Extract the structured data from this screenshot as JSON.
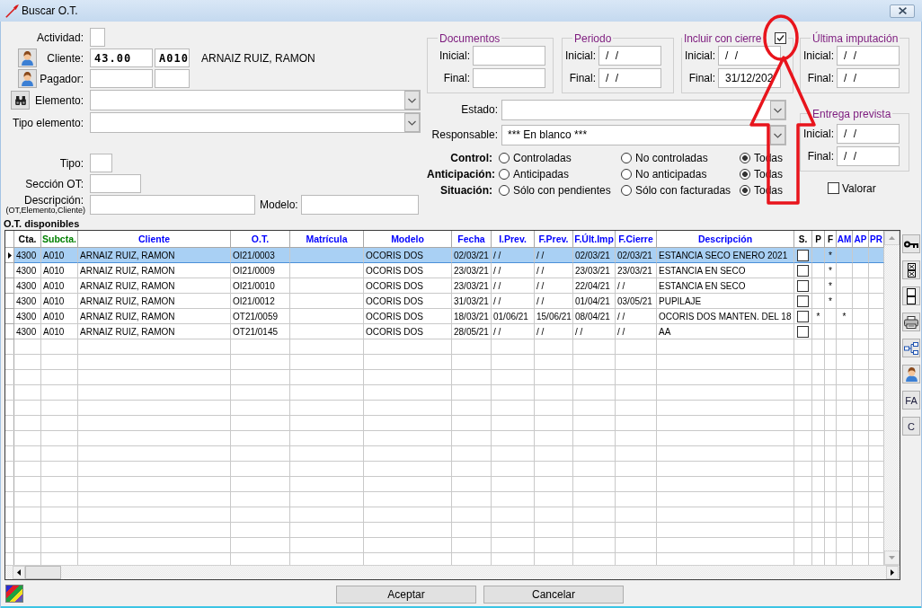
{
  "window": {
    "title": "Buscar O.T."
  },
  "form": {
    "actividad": {
      "label": "Actividad:"
    },
    "cliente": {
      "label": "Cliente:",
      "code": "43.00",
      "subcode": "A010",
      "name": "ARNAIZ RUIZ, RAMON"
    },
    "pagador": {
      "label": "Pagador:"
    },
    "elemento": {
      "label": "Elemento:"
    },
    "tipo_elemento": {
      "label": "Tipo elemento:"
    },
    "tipo": {
      "label": "Tipo:"
    },
    "seccion": {
      "label": "Sección OT:"
    },
    "descripcion": {
      "label": "Descripción:",
      "hint": "(OT,Elemento,Cliente)"
    },
    "modelo": {
      "label": "Modelo:"
    }
  },
  "date_groups": [
    {
      "title": "Documentos",
      "fields": [
        {
          "label": "Inicial:"
        },
        {
          "label": "Final:"
        }
      ]
    },
    {
      "title": "Periodo",
      "fields": [
        {
          "label": "Inicial:",
          "value": "/ /"
        },
        {
          "label": "Final:",
          "value": "/ /"
        }
      ]
    },
    {
      "title": "Incluir con cierre",
      "checkbox": {
        "checked": true
      },
      "fields": [
        {
          "label": "Inicial:",
          "value": "/ /"
        },
        {
          "label": "Final:",
          "value": "31/12/202"
        }
      ]
    },
    {
      "title": "Última imputación",
      "fields": [
        {
          "label": "Inicial:",
          "value": "/ /"
        },
        {
          "label": "Final:",
          "value": "/ /"
        }
      ]
    }
  ],
  "estado": {
    "label": "Estado:"
  },
  "responsable": {
    "label": "Responsable:",
    "value": "*** En blanco ***"
  },
  "radio_groups": [
    {
      "label": "Control:",
      "options": [
        {
          "label": "Controladas",
          "selected": false
        },
        {
          "label": "No controladas",
          "selected": false
        },
        {
          "label": "Todas",
          "selected": true
        }
      ]
    },
    {
      "label": "Anticipación:",
      "options": [
        {
          "label": "Anticipadas",
          "selected": false
        },
        {
          "label": "No anticipadas",
          "selected": false
        },
        {
          "label": "Todas",
          "selected": true
        }
      ]
    },
    {
      "label": "Situación:",
      "options": [
        {
          "label": "Sólo con pendientes",
          "selected": false
        },
        {
          "label": "Sólo con facturadas",
          "selected": false
        },
        {
          "label": "Todas",
          "selected": true
        }
      ]
    }
  ],
  "delivery_group": {
    "title": "Entrega prevista",
    "fields": [
      {
        "label": "Inicial:",
        "value": "/ /"
      },
      {
        "label": "Final:",
        "value": "/ /"
      }
    ]
  },
  "valorar": {
    "label": "Valorar",
    "checked": false
  },
  "table": {
    "title": "O.T. disponibles",
    "columns": [
      {
        "label": "Cta.",
        "color": "#000000",
        "kind": "text"
      },
      {
        "label": "Subcta.",
        "color": "#008000",
        "kind": "text"
      },
      {
        "label": "Cliente",
        "color": "#0000ff",
        "kind": "text"
      },
      {
        "label": "O.T.",
        "color": "#0000ff",
        "kind": "text"
      },
      {
        "label": "Matrícula",
        "color": "#0000ff",
        "kind": "text"
      },
      {
        "label": "Modelo",
        "color": "#0000ff",
        "kind": "text"
      },
      {
        "label": "Fecha",
        "color": "#0000ff",
        "kind": "text"
      },
      {
        "label": "I.Prev.",
        "color": "#0000ff",
        "kind": "text"
      },
      {
        "label": "F.Prev.",
        "color": "#0000ff",
        "kind": "text"
      },
      {
        "label": "F.Últ.Imp",
        "color": "#0000ff",
        "kind": "text"
      },
      {
        "label": "F.Cierre",
        "color": "#0000ff",
        "kind": "text"
      },
      {
        "label": "Descripción",
        "color": "#0000ff",
        "kind": "text"
      },
      {
        "label": "S.",
        "color": "#000000",
        "kind": "checkbox"
      },
      {
        "label": "P",
        "color": "#000000",
        "kind": "text"
      },
      {
        "label": "F",
        "color": "#000000",
        "kind": "text"
      },
      {
        "label": "AM",
        "color": "#0000ff",
        "kind": "text"
      },
      {
        "label": "AP",
        "color": "#0000ff",
        "kind": "text"
      },
      {
        "label": "PR",
        "color": "#0000ff",
        "kind": "text"
      }
    ],
    "rows": [
      {
        "selected": true,
        "cells": [
          "4300",
          "A010",
          "ARNAIZ RUIZ, RAMON",
          "OI21/0003",
          null,
          "OCORIS DOS",
          "02/03/21",
          "/ /",
          "/ /",
          "02/03/21",
          "02/03/21",
          "ESTANCIA SECO ENERO 2021",
          false,
          null,
          "*",
          null,
          null,
          null
        ]
      },
      {
        "selected": false,
        "cells": [
          "4300",
          "A010",
          "ARNAIZ RUIZ, RAMON",
          "OI21/0009",
          null,
          "OCORIS DOS",
          "23/03/21",
          "/ /",
          "/ /",
          "23/03/21",
          "23/03/21",
          "ESTANCIA EN SECO",
          false,
          null,
          "*",
          null,
          null,
          null
        ]
      },
      {
        "selected": false,
        "cells": [
          "4300",
          "A010",
          "ARNAIZ RUIZ, RAMON",
          "OI21/0010",
          null,
          "OCORIS DOS",
          "23/03/21",
          "/ /",
          "/ /",
          "22/04/21",
          "/ /",
          "ESTANCIA EN SECO",
          false,
          null,
          "*",
          null,
          null,
          null
        ]
      },
      {
        "selected": false,
        "cells": [
          "4300",
          "A010",
          "ARNAIZ RUIZ, RAMON",
          "OI21/0012",
          null,
          "OCORIS DOS",
          "31/03/21",
          "/ /",
          "/ /",
          "01/04/21",
          "03/05/21",
          "PUPILAJE",
          false,
          null,
          "*",
          null,
          null,
          null
        ]
      },
      {
        "selected": false,
        "cells": [
          "4300",
          "A010",
          "ARNAIZ RUIZ, RAMON",
          "OT21/0059",
          null,
          "OCORIS DOS",
          "18/03/21",
          "01/06/21",
          "15/06/21",
          "08/04/21",
          "/ /",
          "OCORIS DOS MANTEN. DEL 18",
          false,
          "*",
          null,
          "*",
          null,
          null
        ]
      },
      {
        "selected": false,
        "cells": [
          "4300",
          "A010",
          "ARNAIZ RUIZ, RAMON",
          "OT21/0145",
          null,
          "OCORIS DOS",
          "28/05/21",
          "/ /",
          "/ /",
          "/ /",
          "/ /",
          "AA",
          false,
          null,
          null,
          null,
          null,
          null
        ]
      }
    ]
  },
  "side_toolbar": [
    {
      "kind": "key"
    },
    {
      "kind": "crossed-boxes"
    },
    {
      "kind": "boxes"
    },
    {
      "kind": "printer"
    },
    {
      "kind": "tree"
    },
    {
      "kind": "person"
    },
    {
      "kind": "text",
      "label": "FA"
    },
    {
      "kind": "text",
      "label": "C"
    }
  ],
  "buttons": [
    {
      "label": "Aceptar"
    },
    {
      "label": "Cancelar"
    }
  ]
}
